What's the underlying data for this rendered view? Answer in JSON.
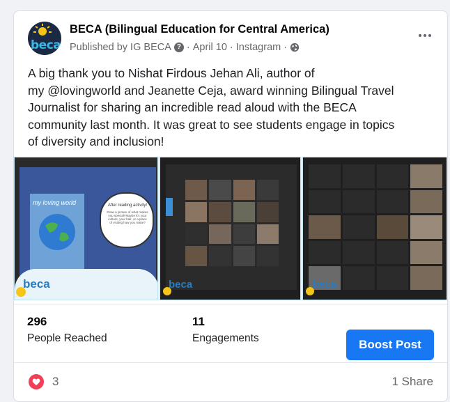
{
  "post": {
    "page_name": "BECA (Bilingual Education for Central America)",
    "avatar_text": "beca",
    "published_by": "Published by IG BECA",
    "date": "April 10",
    "source": "Instagram",
    "separator": "·",
    "message": "A big thank you to Nishat Firdous Jehan Ali, author of\nmy @lovingworld and Jeanette Ceja,  award winning Bilingual Travel\nJournalist for sharing an incredible read aloud with the BECA\ncommunity last month. It was great to see students engage in topics\nof diversity and inclusion!"
  },
  "photos": [
    {
      "logo": "beca",
      "book_title": "my loving world",
      "bubble_title": "After reading activity!",
      "bubble_body": "Draw a picture of what makes you special! Maybe it's your culture, your hair, or a place of visiting how you make?"
    },
    {
      "logo": "beca"
    },
    {
      "logo": "beca"
    }
  ],
  "stats": {
    "reached_value": "296",
    "reached_label": "People Reached",
    "engagements_value": "11",
    "engagements_label": "Engagements",
    "boost_label": "Boost Post"
  },
  "reactions": {
    "count": "3",
    "shares": "1 Share"
  },
  "colors": {
    "accent": "#1877f2",
    "heart": "#f33e58",
    "photo_bg": "#e8f4fa"
  }
}
